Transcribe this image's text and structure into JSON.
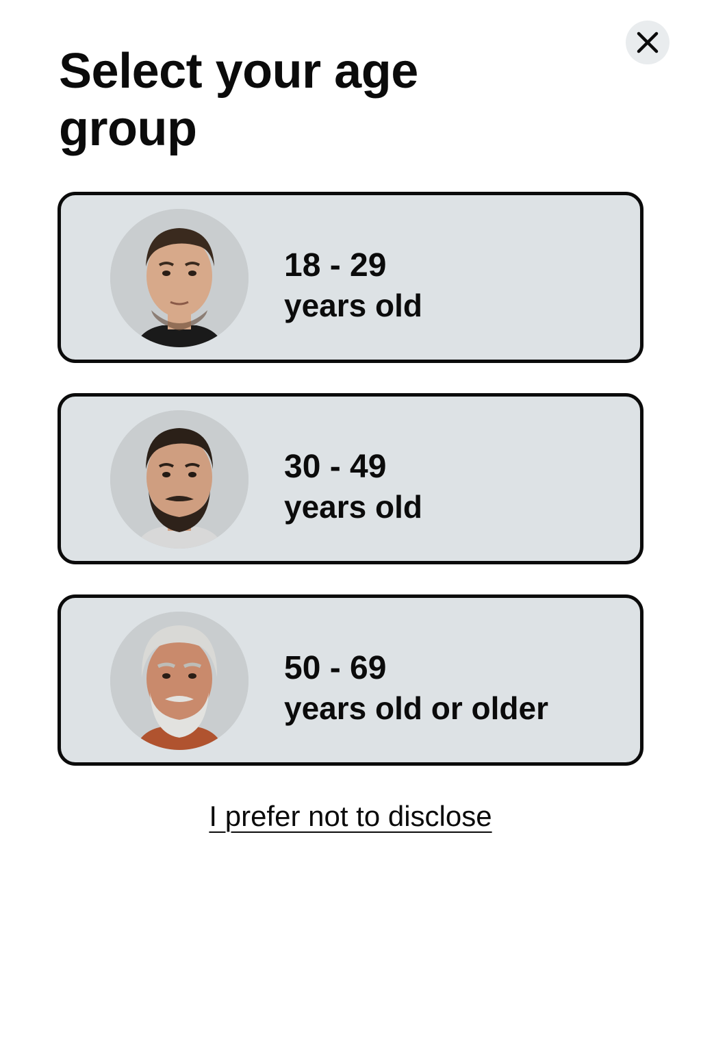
{
  "header": {
    "title": "Select your age group",
    "close_icon": "close-icon"
  },
  "options": [
    {
      "range": "18 - 29",
      "unit": "years old",
      "avatar_icon": "young-man-portrait",
      "hair_color": "#3a2a1e",
      "beard_color": "#5a3e2b",
      "skin_color": "#d7a98a",
      "shirt_color": "#1a1a1a"
    },
    {
      "range": "30 - 49",
      "unit": "years old",
      "avatar_icon": "middle-aged-man-portrait",
      "hair_color": "#2b2018",
      "beard_color": "#2e221a",
      "skin_color": "#cf9e80",
      "shirt_color": "#d8d8d8"
    },
    {
      "range": "50 - 69",
      "unit": "years old or older",
      "avatar_icon": "older-man-portrait",
      "hair_color": "#d9d9d6",
      "beard_color": "#e2e2df",
      "skin_color": "#c98a6c",
      "shirt_color": "#b0532f"
    }
  ],
  "footer": {
    "disclose_label": "I prefer not to disclose"
  },
  "colors": {
    "card_background": "#dde2e5",
    "card_border": "#0b0b0b",
    "close_background": "#e9ecee"
  }
}
